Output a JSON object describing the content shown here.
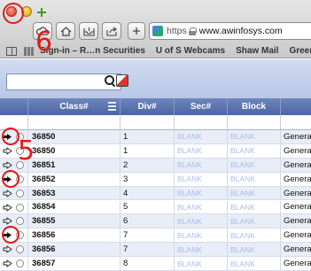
{
  "browser": {
    "url_scheme": "https",
    "url_host": "www.awinfosys.com",
    "bookmarks": [
      "Sign-in – R…n Securities",
      "U of S Webcams",
      "Shaw Mail",
      "Green"
    ]
  },
  "grid": {
    "columns": [
      "Class#",
      "Div#",
      "Sec#",
      "Block"
    ],
    "rows": [
      {
        "class": "36850",
        "div": "1",
        "sec": "BLANK",
        "block": "BLANK",
        "extra": "Generat",
        "arrow": "bold"
      },
      {
        "class": "36850",
        "div": "1",
        "sec": "BLANK",
        "block": "BLANK",
        "extra": "Generat",
        "arrow": "outline"
      },
      {
        "class": "36851",
        "div": "2",
        "sec": "BLANK",
        "block": "BLANK",
        "extra": "Generat",
        "arrow": "outline"
      },
      {
        "class": "36852",
        "div": "3",
        "sec": "BLANK",
        "block": "BLANK",
        "extra": "Generat",
        "arrow": "bold"
      },
      {
        "class": "36853",
        "div": "4",
        "sec": "BLANK",
        "block": "BLANK",
        "extra": "Generat",
        "arrow": "outline"
      },
      {
        "class": "36854",
        "div": "5",
        "sec": "BLANK",
        "block": "BLANK",
        "extra": "Generat",
        "arrow": "outline"
      },
      {
        "class": "36855",
        "div": "6",
        "sec": "BLANK",
        "block": "BLANK",
        "extra": "Generat",
        "arrow": "outline"
      },
      {
        "class": "36856",
        "div": "7",
        "sec": "BLANK",
        "block": "BLANK",
        "extra": "Generat",
        "arrow": "bold"
      },
      {
        "class": "36856",
        "div": "7",
        "sec": "BLANK",
        "block": "BLANK",
        "extra": "Generat",
        "arrow": "outline"
      },
      {
        "class": "36857",
        "div": "8",
        "sec": "BLANK",
        "block": "BLANK",
        "extra": "Generat",
        "arrow": "outline"
      }
    ]
  },
  "annotations": {
    "label_close": "6",
    "label_rows": "5",
    "color": "#e01a1a"
  },
  "colors": {
    "header_bg": "#5a72ae",
    "toolbar_bg": "#c4d1ea",
    "blank_text": "#a9bfe7",
    "row_alt": "#e9edf7"
  }
}
